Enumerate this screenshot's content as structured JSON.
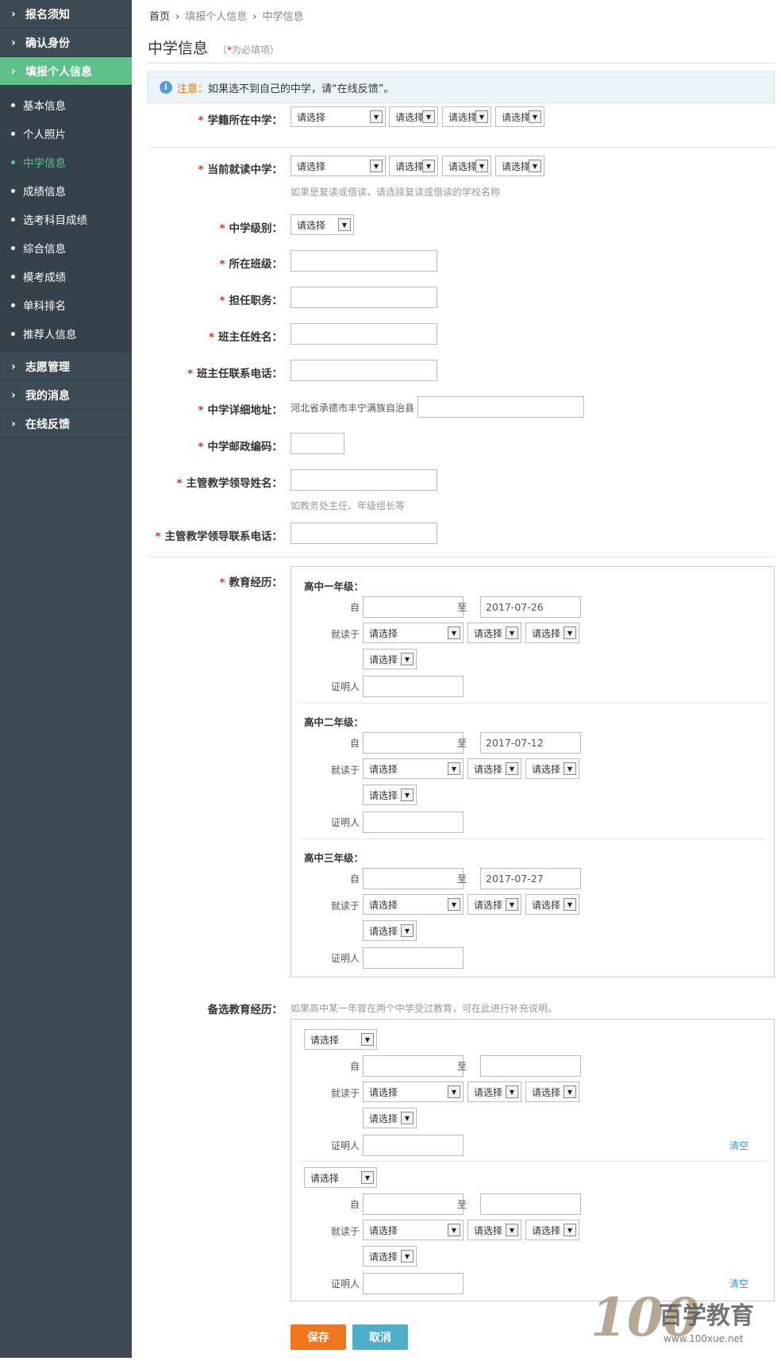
{
  "sidebar": {
    "sections_top": [
      "报名须知",
      "确认身份",
      "填报个人信息"
    ],
    "sub": [
      "基本信息",
      "个人照片",
      "中学信息",
      "成绩信息",
      "选考科目成绩",
      "综合信息",
      "模考成绩",
      "单科排名",
      "推荐人信息"
    ],
    "sections_bottom": [
      "志愿管理",
      "我的消息",
      "在线反馈"
    ]
  },
  "breadcrumb": {
    "home": "首页",
    "level2": "填报个人信息",
    "level3": "中学信息",
    "sep": "›"
  },
  "title": "中学信息",
  "required_note": {
    "open": "（",
    "star": "*",
    "text": "为必填项",
    "close": "）"
  },
  "notice": {
    "icon": "i",
    "prefix": "注意：",
    "text": "如果选不到自己的中学，请",
    "link": "“在线反馈”",
    "suffix": "。"
  },
  "select_placeholder": "请选择",
  "labels": {
    "school_reg": "学籍所在中学：",
    "school_cur": "当前就读中学：",
    "level": "中学级别：",
    "class": "所在班级：",
    "duty": "担任职务：",
    "teacher_name": "班主任姓名：",
    "teacher_phone": "班主任联系电话：",
    "address": "中学详细地址：",
    "postcode": "中学邮政编码：",
    "leader_name": "主管教学领导姓名：",
    "leader_phone": "主管教学领导联系电话：",
    "edu": "教育经历：",
    "alt_edu": "备选教育经历："
  },
  "star": "*",
  "hints": {
    "school_cur": "如果是复读或借读，请选择复读或借读的学校名称",
    "leader_name": "如教务处主任、年级组长等",
    "alt_edu": "如果高中某一年曾在两个中学受过教育，可在此进行补充说明。"
  },
  "address_prefix": "河北省承德市丰宁满族自治县",
  "edu": {
    "from": "自",
    "to": "至",
    "study": "就读于",
    "witness": "证明人",
    "grades": [
      {
        "name": "高中一年级：",
        "to_date": "2017-07-26"
      },
      {
        "name": "高中二年级：",
        "to_date": "2017-07-12"
      },
      {
        "name": "高中三年级：",
        "to_date": "2017-07-27"
      }
    ]
  },
  "clear_label": "清空",
  "buttons": {
    "save": "保存",
    "cancel": "取消"
  },
  "watermark": {
    "number": "100",
    "brand": "百学教育",
    "url": "www.100xue.net"
  },
  "colors": {
    "sidebar": "#3c4a54",
    "accent": "#5fc189",
    "save": "#f0761e",
    "cancel": "#4eaec9"
  }
}
